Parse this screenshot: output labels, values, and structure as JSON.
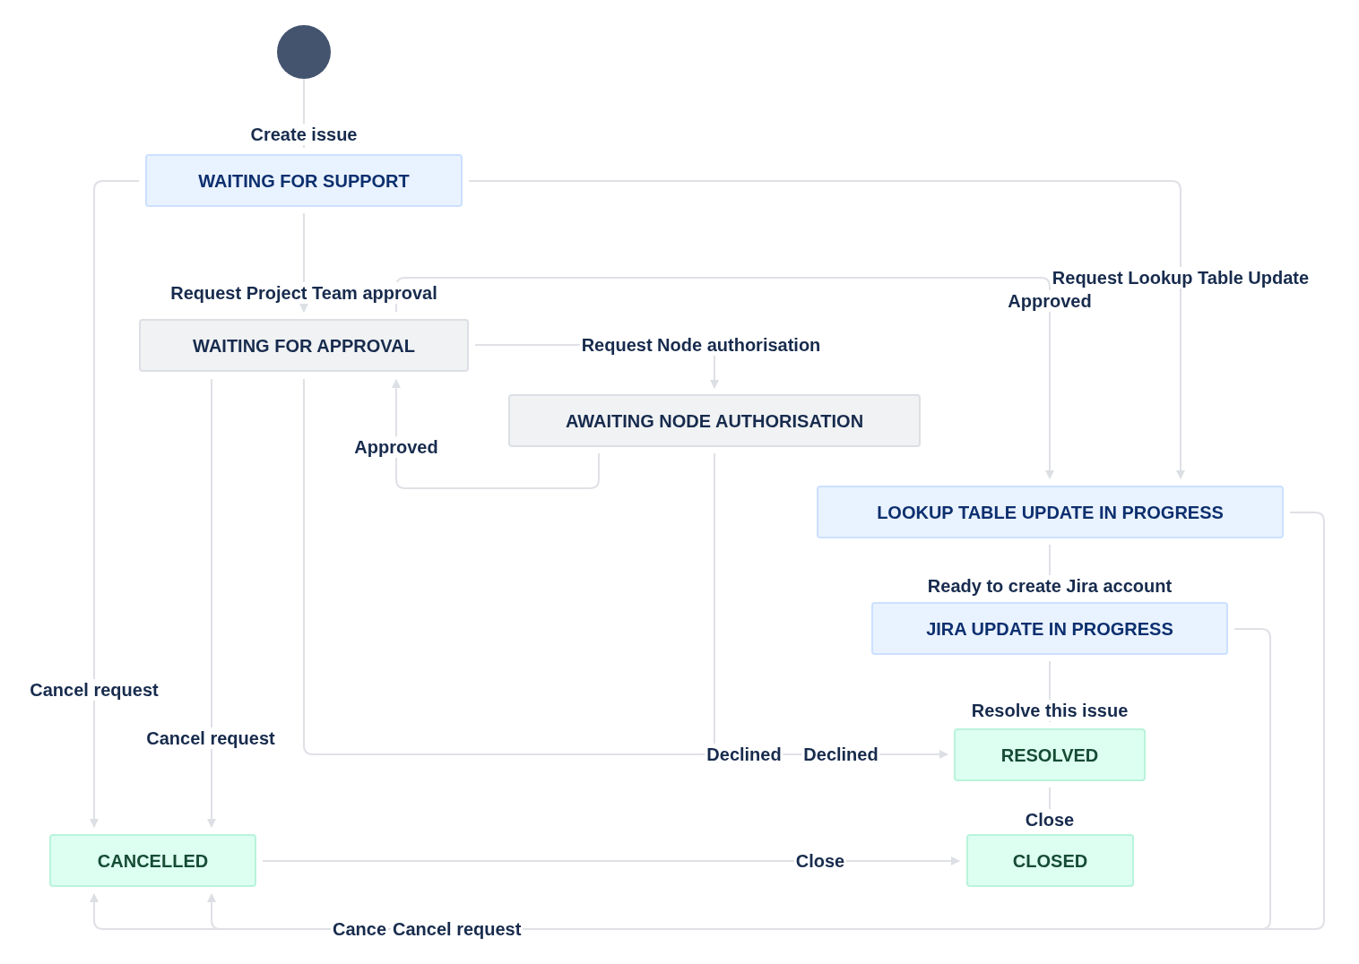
{
  "start": {
    "kind": "start"
  },
  "statuses": [
    {
      "label": "WAITING FOR SUPPORT",
      "kind": "progress"
    },
    {
      "label": "WAITING FOR APPROVAL",
      "kind": "todo"
    },
    {
      "label": "AWAITING NODE AUTHORISATION",
      "kind": "todo"
    },
    {
      "label": "LOOKUP TABLE UPDATE IN PROGRESS",
      "kind": "progress"
    },
    {
      "label": "JIRA UPDATE IN PROGRESS",
      "kind": "progress"
    },
    {
      "label": "RESOLVED",
      "kind": "done"
    },
    {
      "label": "CANCELLED",
      "kind": "done"
    },
    {
      "label": "CLOSED",
      "kind": "done"
    }
  ],
  "transitions": [
    {
      "label": "Create issue"
    },
    {
      "label": "Request Project Team approval"
    },
    {
      "label": "Request Lookup Table Update"
    },
    {
      "label": "Approved"
    },
    {
      "label": "Request Node authorisation"
    },
    {
      "label": "Approved"
    },
    {
      "label": "Cancel request"
    },
    {
      "label": "Cancel request"
    },
    {
      "label": "Declined"
    },
    {
      "label": "Declined"
    },
    {
      "label": "Ready to create Jira account"
    },
    {
      "label": "Resolve this issue"
    },
    {
      "label": "Close"
    },
    {
      "label": "Close"
    },
    {
      "label": "Cance"
    },
    {
      "label": "Cancel request"
    }
  ]
}
